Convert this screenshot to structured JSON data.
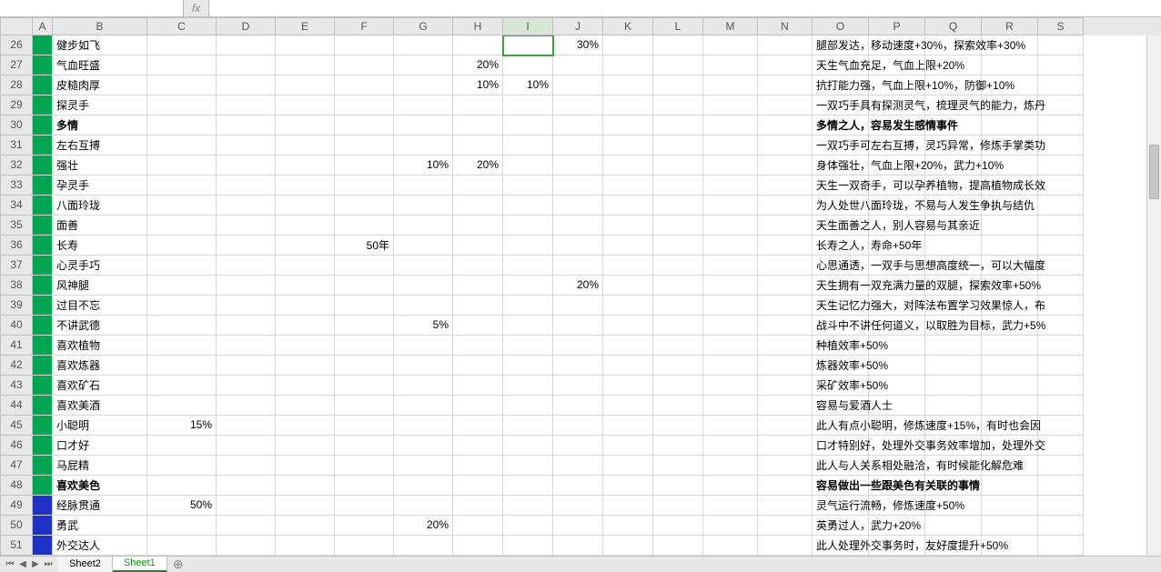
{
  "formula_bar": {
    "name_box": "",
    "fx_label": "fx",
    "value": ""
  },
  "columns": [
    "A",
    "B",
    "C",
    "D",
    "E",
    "F",
    "G",
    "H",
    "I",
    "J",
    "K",
    "L",
    "M",
    "N",
    "O",
    "P",
    "Q",
    "R",
    "S"
  ],
  "active_col": "I",
  "col_widths": {
    "A": 22,
    "B": 104,
    "C": 76,
    "D": 65,
    "E": 65,
    "F": 65,
    "G": 65,
    "H": 55,
    "I": 55,
    "J": 55,
    "K": 55,
    "L": 55,
    "M": 60,
    "N": 60,
    "O": 62,
    "P": 62,
    "Q": 62,
    "R": 62,
    "S": 50
  },
  "first_row": 26,
  "selected_cell": {
    "row": 26,
    "col": "I"
  },
  "colors": {
    "green": "#00a651",
    "blue": "#1f30c7",
    "grid": "#d7d7d7",
    "header_bg": "#e8e8e8",
    "accent": "#3ba23b"
  },
  "rows": [
    {
      "r": 26,
      "fill": "green",
      "bold": false,
      "B": "健步如飞",
      "J": "30%",
      "desc": "腿部发达，移动速度+30%，探索效率+30%"
    },
    {
      "r": 27,
      "fill": "green",
      "bold": false,
      "B": "气血旺盛",
      "H": "20%",
      "desc": "天生气血充足，气血上限+20%"
    },
    {
      "r": 28,
      "fill": "green",
      "bold": false,
      "B": "皮糙肉厚",
      "H": "10%",
      "I": "10%",
      "desc": "抗打能力强，气血上限+10%，防御+10%"
    },
    {
      "r": 29,
      "fill": "green",
      "bold": false,
      "B": "探灵手",
      "desc": "一双巧手具有探测灵气，梳理灵气的能力，炼丹"
    },
    {
      "r": 30,
      "fill": "green",
      "bold": true,
      "B": "多情",
      "desc": "多情之人，容易发生感情事件"
    },
    {
      "r": 31,
      "fill": "green",
      "bold": false,
      "B": "左右互搏",
      "desc": "一双巧手可左右互搏，灵巧异常，修炼手掌类功"
    },
    {
      "r": 32,
      "fill": "green",
      "bold": false,
      "B": "强壮",
      "G": "10%",
      "H": "20%",
      "desc": "身体强壮，气血上限+20%，武力+10%"
    },
    {
      "r": 33,
      "fill": "green",
      "bold": false,
      "B": "孕灵手",
      "desc": "天生一双奇手，可以孕养植物，提高植物成长效"
    },
    {
      "r": 34,
      "fill": "green",
      "bold": false,
      "B": "八面玲珑",
      "desc": "为人处世八面玲珑，不易与人发生争执与结仇"
    },
    {
      "r": 35,
      "fill": "green",
      "bold": false,
      "B": "面善",
      "desc": "天生面善之人，别人容易与其亲近"
    },
    {
      "r": 36,
      "fill": "green",
      "bold": false,
      "B": "长寿",
      "F": "50年",
      "desc": "长寿之人，寿命+50年"
    },
    {
      "r": 37,
      "fill": "green",
      "bold": false,
      "B": "心灵手巧",
      "desc": "心思通透，一双手与思想高度统一，可以大幅度"
    },
    {
      "r": 38,
      "fill": "green",
      "bold": false,
      "B": "风神腿",
      "J": "20%",
      "desc": "天生拥有一双充满力量的双腿，探索效率+50%"
    },
    {
      "r": 39,
      "fill": "green",
      "bold": false,
      "B": "过目不忘",
      "desc": "天生记忆力强大，对阵法布置学习效果惊人，布"
    },
    {
      "r": 40,
      "fill": "green",
      "bold": false,
      "B": "不讲武德",
      "G": "5%",
      "desc": "战斗中不讲任何道义，以取胜为目标，武力+5%"
    },
    {
      "r": 41,
      "fill": "green",
      "bold": false,
      "B": "喜欢植物",
      "desc": "种植效率+50%"
    },
    {
      "r": 42,
      "fill": "green",
      "bold": false,
      "B": "喜欢炼器",
      "desc": "炼器效率+50%"
    },
    {
      "r": 43,
      "fill": "green",
      "bold": false,
      "B": "喜欢矿石",
      "desc": "采矿效率+50%"
    },
    {
      "r": 44,
      "fill": "green",
      "bold": false,
      "B": "喜欢美酒",
      "desc": "容易与爱酒人士"
    },
    {
      "r": 45,
      "fill": "green",
      "bold": false,
      "B": "小聪明",
      "C": "15%",
      "desc": "此人有点小聪明，修炼速度+15%，有时也会因"
    },
    {
      "r": 46,
      "fill": "green",
      "bold": false,
      "B": "口才好",
      "desc": "口才特别好，处理外交事务效率增加，处理外交"
    },
    {
      "r": 47,
      "fill": "green",
      "bold": false,
      "B": "马屁精",
      "desc": "此人与人关系相处融洽，有时候能化解危难"
    },
    {
      "r": 48,
      "fill": "green",
      "bold": true,
      "B": "喜欢美色",
      "desc": "容易做出一些跟美色有关联的事情"
    },
    {
      "r": 49,
      "fill": "blue",
      "bold": false,
      "B": "经脉贯通",
      "C": "50%",
      "desc": "灵气运行流畅，修炼速度+50%"
    },
    {
      "r": 50,
      "fill": "blue",
      "bold": false,
      "B": "勇武",
      "G": "20%",
      "desc": "英勇过人，武力+20%"
    },
    {
      "r": 51,
      "fill": "blue",
      "bold": false,
      "B": "外交达人",
      "desc": "此人处理外交事务时，友好度提升+50%"
    }
  ],
  "tabs": {
    "nav": {
      "first": "⏮",
      "prev": "◀",
      "next": "▶",
      "last": "⏭"
    },
    "items": [
      {
        "label": "Sheet2",
        "active": false
      },
      {
        "label": "Sheet1",
        "active": true
      }
    ],
    "new_icon": "⊕"
  }
}
